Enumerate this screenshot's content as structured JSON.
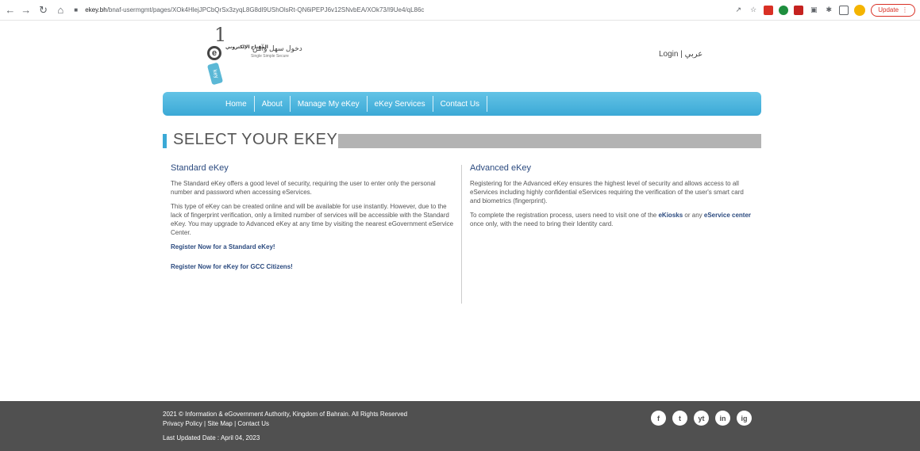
{
  "browser": {
    "url_domain": "ekey.bh",
    "url_path": "/bnaf-usermgmt/pages/XOk4HlejJPCbQrSx3zyqL8G8dI9UShOlsRt-QN6iPEPJ6v12SNvbEA/XOk73/I9Ue4/qL86c",
    "update_label": "Update"
  },
  "header": {
    "logo_number": "1",
    "logo_letter": "e",
    "logo_tag": "key",
    "logo_arabic_main": "دخول سهل وآمن",
    "logo_arabic_small": "المفتاح الإلكتروني",
    "logo_english": "Single Simple Secure",
    "login_label": "Login | عربي"
  },
  "nav": {
    "items": [
      "Home",
      "About",
      "Manage My eKey",
      "eKey Services",
      "Contact Us"
    ]
  },
  "page_title": "SELECT YOUR EKEY",
  "standard": {
    "title": "Standard eKey",
    "para1": "The Standard eKey offers a good level of security, requiring the user to enter only the personal number and password when accessing eServices.",
    "para2": "This type of eKey can be created online and will be available for use instantly. However, due to the lack of fingerprint verification, only a limited number of services will be accessible with the Standard eKey. You may upgrade to Advanced eKey at any time by visiting the nearest eGovernment eService Center.",
    "link1": "Register Now for a Standard eKey!",
    "link2": "Register Now for eKey for GCC Citizens!"
  },
  "advanced": {
    "title": "Advanced eKey",
    "para1": "Registering for the Advanced eKey ensures the highest level of security and allows access to all eServices including highly confidential eServices requiring the verification of the user's smart card and biometrics (fingerprint).",
    "para2_prefix": "To complete the registration process, users need to visit one of the",
    "para2_link1": "eKiosks",
    "para2_mid": "or any",
    "para2_link2": "eService center",
    "para2_suffix": "once only, with the need to bring their Identity card."
  },
  "footer": {
    "copyright": "2021 © Information & eGovernment Authority, Kingdom of Bahrain. All Rights Reserved",
    "links": "Privacy Policy | Site Map | Contact Us",
    "updated": "Last Updated Date : April 04, 2023",
    "social": [
      "f",
      "t",
      "yt",
      "in",
      "ig"
    ]
  },
  "colors": {
    "nav_blue": "#3ba9d6",
    "link_navy": "#2b4a7f",
    "footer_gray": "#505050"
  }
}
